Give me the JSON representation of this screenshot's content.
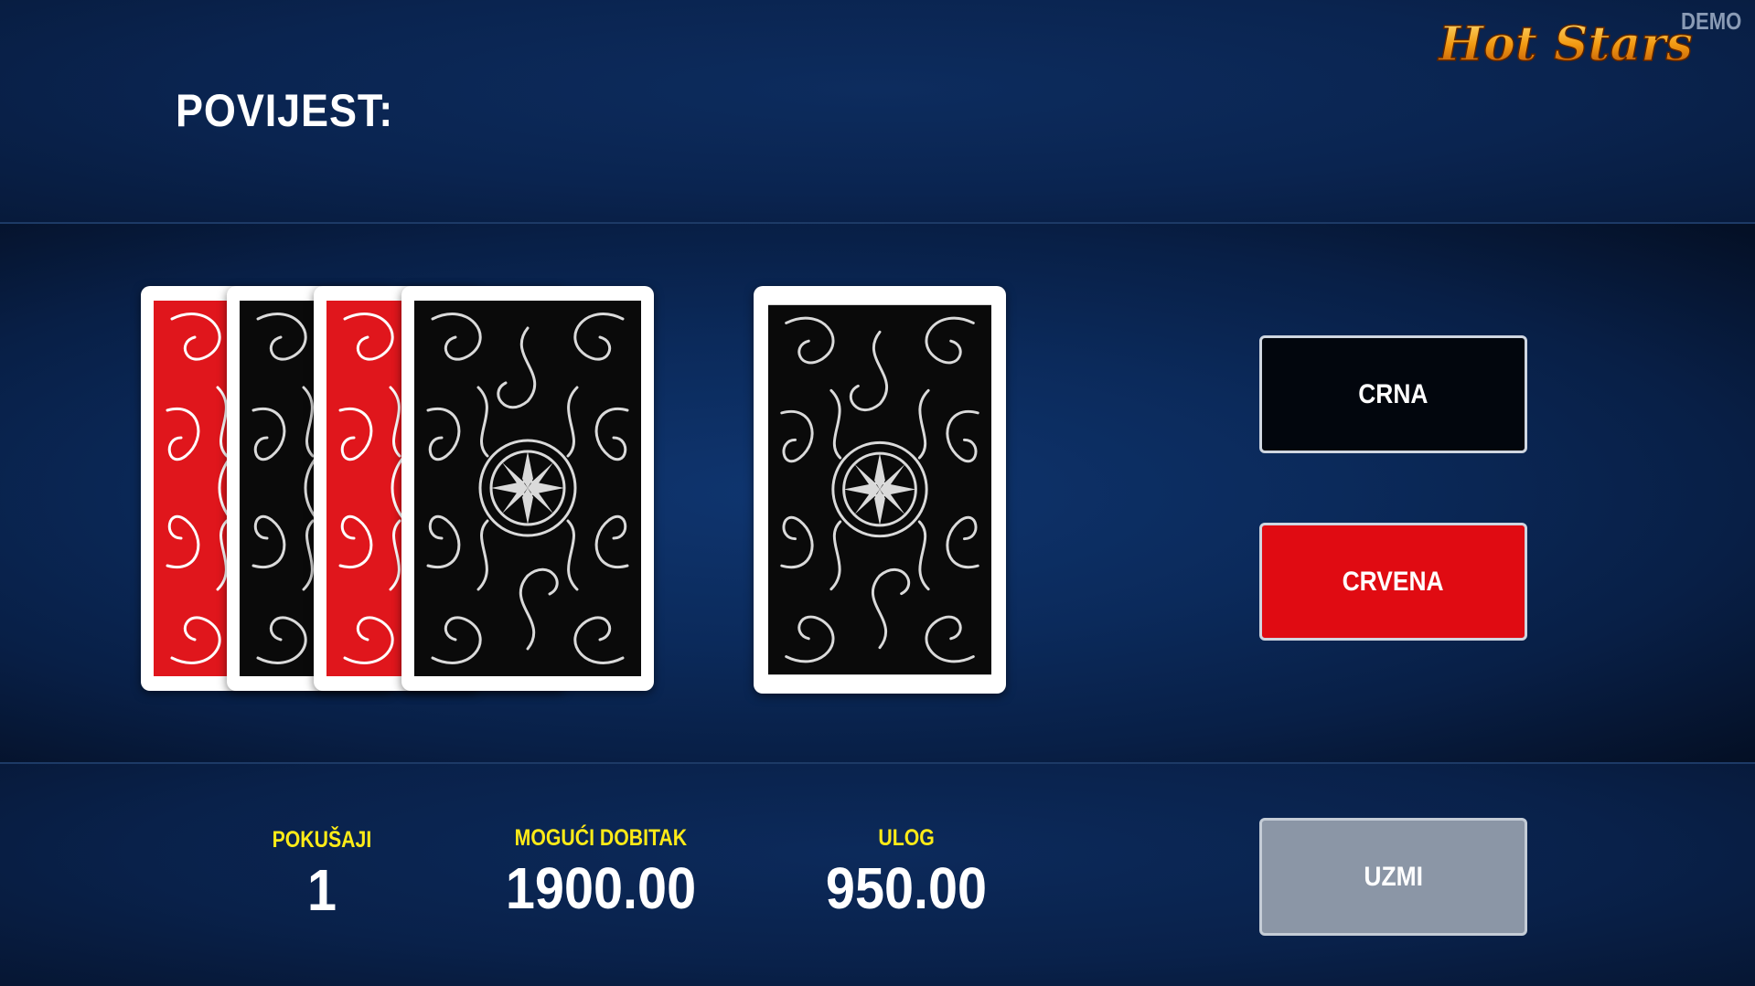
{
  "header": {
    "history_label": "POVIJEST:",
    "logo_text": "Hot Stars",
    "demo_label": "DEMO"
  },
  "history_cards": [
    {
      "back_color": "red"
    },
    {
      "back_color": "black"
    },
    {
      "back_color": "red"
    },
    {
      "back_color": "black"
    }
  ],
  "current_card": {
    "back_color": "black",
    "state": "face-down"
  },
  "buttons": {
    "black_label": "CRNA",
    "red_label": "CRVENA",
    "take_label": "UZMI"
  },
  "stats": {
    "attempts_label": "POKUŠAJI",
    "attempts_value": "1",
    "possible_win_label": "MOGUĆI DOBITAK",
    "possible_win_value": "1900.00",
    "bet_label": "ULOG",
    "bet_value": "950.00"
  },
  "colors": {
    "black_button": "#02060d",
    "red_button": "#e00b12",
    "take_button": "#8b96a6",
    "label_yellow": "#ffeb17",
    "card_red": "#e0161c",
    "card_black": "#0a0a0a"
  }
}
